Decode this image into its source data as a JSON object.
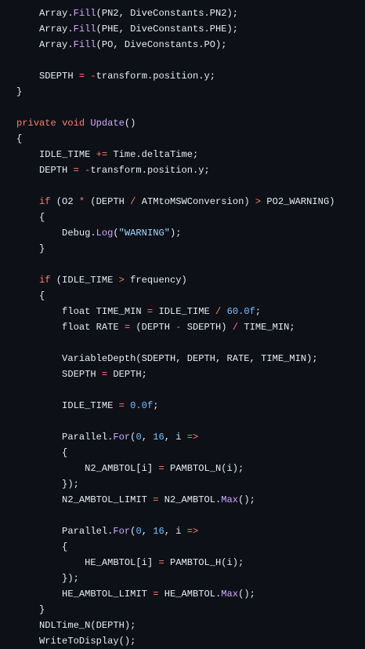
{
  "editor": {
    "theme_colors": {
      "background": "#0d1117",
      "text": "#e6edf3",
      "keyword": "#ff7b72",
      "function": "#d2a8ff",
      "number": "#79c0ff",
      "string": "#a5d6ff"
    },
    "lines": [
      [
        {
          "t": "    Array."
        },
        {
          "t": "Fill",
          "k": "fn"
        },
        {
          "t": "(PN2, DiveConstants.PN2);"
        }
      ],
      [
        {
          "t": "    Array."
        },
        {
          "t": "Fill",
          "k": "fn"
        },
        {
          "t": "(PHE, DiveConstants.PHE);"
        }
      ],
      [
        {
          "t": "    Array."
        },
        {
          "t": "Fill",
          "k": "fn"
        },
        {
          "t": "(PO, DiveConstants.PO);"
        }
      ],
      [],
      [
        {
          "t": "    SDEPTH "
        },
        {
          "t": "=",
          "k": "op"
        },
        {
          "t": " "
        },
        {
          "t": "-",
          "k": "op"
        },
        {
          "t": "transform.position.y;"
        }
      ],
      [
        {
          "t": "}"
        }
      ],
      [],
      [
        {
          "t": "private",
          "k": "kw"
        },
        {
          "t": " "
        },
        {
          "t": "void",
          "k": "kw"
        },
        {
          "t": " "
        },
        {
          "t": "Update",
          "k": "fn"
        },
        {
          "t": "()"
        }
      ],
      [
        {
          "t": "{"
        }
      ],
      [
        {
          "t": "    IDLE_TIME "
        },
        {
          "t": "+=",
          "k": "op"
        },
        {
          "t": " Time.deltaTime;"
        }
      ],
      [
        {
          "t": "    DEPTH "
        },
        {
          "t": "=",
          "k": "op"
        },
        {
          "t": " "
        },
        {
          "t": "-",
          "k": "op"
        },
        {
          "t": "transform.position.y;"
        }
      ],
      [],
      [
        {
          "t": "    "
        },
        {
          "t": "if",
          "k": "kw"
        },
        {
          "t": " (O2 "
        },
        {
          "t": "*",
          "k": "op"
        },
        {
          "t": " (DEPTH "
        },
        {
          "t": "/",
          "k": "op"
        },
        {
          "t": " ATMtoMSWConversion) "
        },
        {
          "t": ">",
          "k": "op"
        },
        {
          "t": " PO2_WARNING)"
        }
      ],
      [
        {
          "t": "    {"
        }
      ],
      [
        {
          "t": "        Debug."
        },
        {
          "t": "Log",
          "k": "fn"
        },
        {
          "t": "("
        },
        {
          "t": "\"WARNING\"",
          "k": "str"
        },
        {
          "t": ");"
        }
      ],
      [
        {
          "t": "    }"
        }
      ],
      [],
      [
        {
          "t": "    "
        },
        {
          "t": "if",
          "k": "kw"
        },
        {
          "t": " (IDLE_TIME "
        },
        {
          "t": ">",
          "k": "op"
        },
        {
          "t": " frequency)"
        }
      ],
      [
        {
          "t": "    {"
        }
      ],
      [
        {
          "t": "        float TIME_MIN "
        },
        {
          "t": "=",
          "k": "op"
        },
        {
          "t": " IDLE_TIME "
        },
        {
          "t": "/",
          "k": "op"
        },
        {
          "t": " "
        },
        {
          "t": "60.0f",
          "k": "num"
        },
        {
          "t": ";"
        }
      ],
      [
        {
          "t": "        float RATE "
        },
        {
          "t": "=",
          "k": "op"
        },
        {
          "t": " (DEPTH "
        },
        {
          "t": "-",
          "k": "op"
        },
        {
          "t": " SDEPTH) "
        },
        {
          "t": "/",
          "k": "op"
        },
        {
          "t": " TIME_MIN;"
        }
      ],
      [],
      [
        {
          "t": "        VariableDepth(SDEPTH, DEPTH, RATE, TIME_MIN);"
        }
      ],
      [
        {
          "t": "        SDEPTH "
        },
        {
          "t": "=",
          "k": "op"
        },
        {
          "t": " DEPTH;"
        }
      ],
      [],
      [
        {
          "t": "        IDLE_TIME "
        },
        {
          "t": "=",
          "k": "op"
        },
        {
          "t": " "
        },
        {
          "t": "0.0f",
          "k": "num"
        },
        {
          "t": ";"
        }
      ],
      [],
      [
        {
          "t": "        Parallel."
        },
        {
          "t": "For",
          "k": "fn"
        },
        {
          "t": "("
        },
        {
          "t": "0",
          "k": "num"
        },
        {
          "t": ", "
        },
        {
          "t": "16",
          "k": "num"
        },
        {
          "t": ", i "
        },
        {
          "t": "=>",
          "k": "op"
        }
      ],
      [
        {
          "t": "        {"
        }
      ],
      [
        {
          "t": "            N2_AMBTOL[i] "
        },
        {
          "t": "=",
          "k": "op"
        },
        {
          "t": " PAMBTOL_N(i);"
        }
      ],
      [
        {
          "t": "        });"
        }
      ],
      [
        {
          "t": "        N2_AMBTOL_LIMIT "
        },
        {
          "t": "=",
          "k": "op"
        },
        {
          "t": " N2_AMBTOL."
        },
        {
          "t": "Max",
          "k": "fn"
        },
        {
          "t": "();"
        }
      ],
      [],
      [
        {
          "t": "        Parallel."
        },
        {
          "t": "For",
          "k": "fn"
        },
        {
          "t": "("
        },
        {
          "t": "0",
          "k": "num"
        },
        {
          "t": ", "
        },
        {
          "t": "16",
          "k": "num"
        },
        {
          "t": ", i "
        },
        {
          "t": "=>",
          "k": "op"
        }
      ],
      [
        {
          "t": "        {"
        }
      ],
      [
        {
          "t": "            HE_AMBTOL[i] "
        },
        {
          "t": "=",
          "k": "op"
        },
        {
          "t": " PAMBTOL_H(i);"
        }
      ],
      [
        {
          "t": "        });"
        }
      ],
      [
        {
          "t": "        HE_AMBTOL_LIMIT "
        },
        {
          "t": "=",
          "k": "op"
        },
        {
          "t": " HE_AMBTOL."
        },
        {
          "t": "Max",
          "k": "fn"
        },
        {
          "t": "();"
        }
      ],
      [
        {
          "t": "    }"
        }
      ],
      [
        {
          "t": "    NDLTime_N(DEPTH);"
        }
      ],
      [
        {
          "t": "    WriteToDisplay();"
        }
      ]
    ]
  }
}
